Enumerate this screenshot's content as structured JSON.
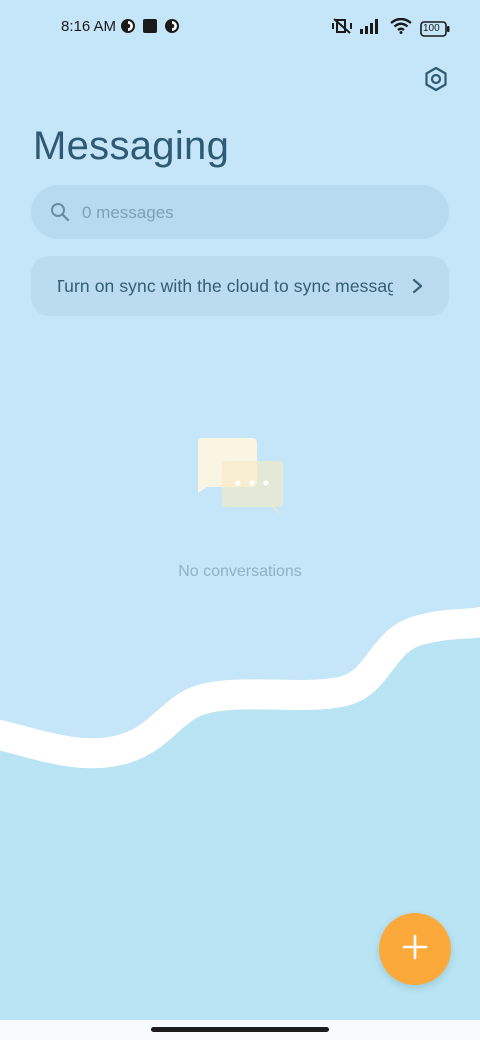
{
  "status_bar": {
    "time": "8:16 AM",
    "battery": "100",
    "left_icons": [
      "notification-app-icon",
      "square-app-icon",
      "notification-app-icon"
    ],
    "right_icons": [
      "vibrate-off-icon",
      "signal-icon",
      "wifi-icon",
      "battery-icon"
    ]
  },
  "header": {
    "title": "Messaging",
    "settings_icon": "settings-hexagon-icon"
  },
  "search": {
    "placeholder": "0 messages",
    "value": ""
  },
  "sync_banner": {
    "text": "Turn on sync with the cloud to sync messages"
  },
  "empty_state": {
    "text": "No conversations"
  },
  "fab": {
    "icon": "plus-icon",
    "color": "#fba93b"
  },
  "colors": {
    "background": "#c5e6f8",
    "accent": "#fba93b",
    "title": "#2e5a73"
  }
}
